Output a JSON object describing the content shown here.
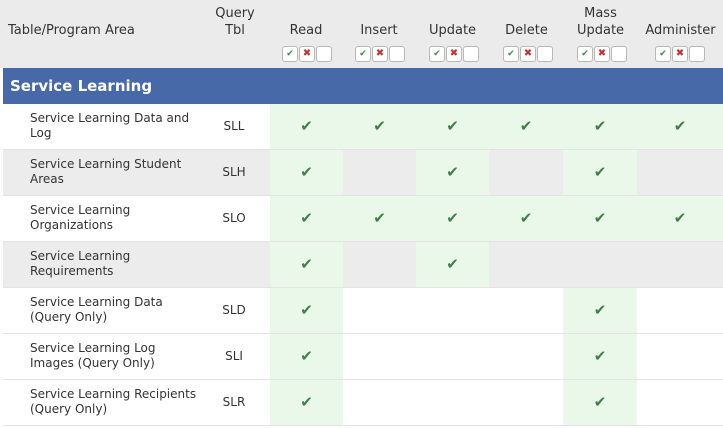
{
  "header": {
    "table_program_area": "Table/Program Area",
    "query_tbl_line1": "Query",
    "query_tbl_line2": "Tbl",
    "read": "Read",
    "insert": "Insert",
    "update": "Update",
    "delete": "Delete",
    "mass_update_line1": "Mass",
    "mass_update_line2": "Update",
    "administer": "Administer"
  },
  "toolbar_glyphs": {
    "check": "✔",
    "cross": "✖"
  },
  "section": {
    "title": "Service Learning"
  },
  "check_glyph": "✔",
  "colors": {
    "section_bg": "#4769a8",
    "granted_bg": "#eaf8ea",
    "check": "#3e7f4a",
    "cross": "#c83030"
  },
  "rows": [
    {
      "name_line1": "Service Learning Data and",
      "name_line2": "Log",
      "code": "SLL",
      "perms": {
        "read": true,
        "insert": true,
        "update": true,
        "delete": true,
        "mass_update": true,
        "administer": true
      }
    },
    {
      "name_line1": "Service Learning Student",
      "name_line2": "Areas",
      "code": "SLH",
      "perms": {
        "read": true,
        "insert": false,
        "update": true,
        "delete": false,
        "mass_update": true,
        "administer": false
      }
    },
    {
      "name_line1": "Service Learning",
      "name_line2": "Organizations",
      "code": "SLO",
      "perms": {
        "read": true,
        "insert": true,
        "update": true,
        "delete": true,
        "mass_update": true,
        "administer": true
      }
    },
    {
      "name_line1": "Service Learning",
      "name_line2": "Requirements",
      "code": "",
      "perms": {
        "read": true,
        "insert": false,
        "update": true,
        "delete": false,
        "mass_update": false,
        "administer": false
      }
    },
    {
      "name_line1": "Service Learning Data",
      "name_line2": "(Query Only)",
      "code": "SLD",
      "perms": {
        "read": true,
        "insert": false,
        "update": false,
        "delete": false,
        "mass_update": true,
        "administer": false
      }
    },
    {
      "name_line1": "Service Learning Log",
      "name_line2": "Images (Query Only)",
      "code": "SLI",
      "perms": {
        "read": true,
        "insert": false,
        "update": false,
        "delete": false,
        "mass_update": true,
        "administer": false
      }
    },
    {
      "name_line1": "Service Learning Recipients",
      "name_line2": "(Query Only)",
      "code": "SLR",
      "perms": {
        "read": true,
        "insert": false,
        "update": false,
        "delete": false,
        "mass_update": true,
        "administer": false
      }
    }
  ]
}
